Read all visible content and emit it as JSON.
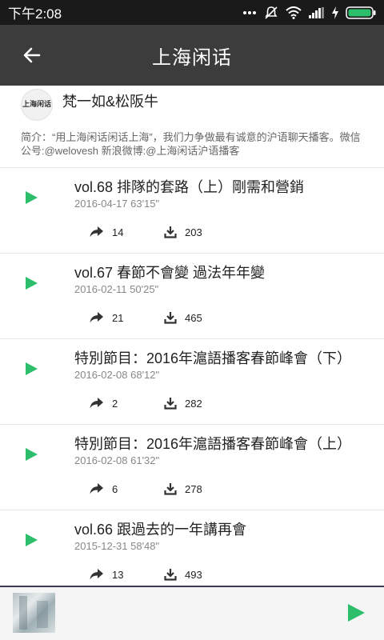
{
  "status_bar": {
    "time": "下午2:08",
    "icons": [
      "dots-icon",
      "mute-icon",
      "wifi-icon",
      "signal-icon",
      "charging-icon",
      "battery-icon"
    ]
  },
  "app_bar": {
    "title": "上海闲话",
    "back_icon": "arrow-left-icon"
  },
  "podcast": {
    "avatar_text": "上海闲话",
    "author": "梵一如&松阪牛",
    "description": "简介：“用上海闲话闲话上海”，我们力争做最有诚意的沪语聊天播客。微信公号:@welovesh  新浪微博:@上海闲话沪语播客"
  },
  "episodes": [
    {
      "title": "vol.68 排隊的套路（上）剛需和營銷",
      "meta": "2016-04-17  63'15\"",
      "shares": "14",
      "downloads": "203"
    },
    {
      "title": "vol.67 春節不會變 過法年年變",
      "meta": "2016-02-11  50'25\"",
      "shares": "21",
      "downloads": "465"
    },
    {
      "title": "特別節目：2016年滬語播客春節峰會（下）",
      "meta": "2016-02-08  68'12\"",
      "shares": "2",
      "downloads": "282"
    },
    {
      "title": "特別節目：2016年滬語播客春節峰會（上）",
      "meta": "2016-02-08  61'32\"",
      "shares": "6",
      "downloads": "278"
    },
    {
      "title": "vol.66 跟過去的一年講再會",
      "meta": "2015-12-31  58'48\"",
      "shares": "13",
      "downloads": "493"
    }
  ],
  "colors": {
    "accent_green": "#2dbe6c",
    "app_bar": "#3c3c3c",
    "status_bar": "#1a1a1a"
  }
}
